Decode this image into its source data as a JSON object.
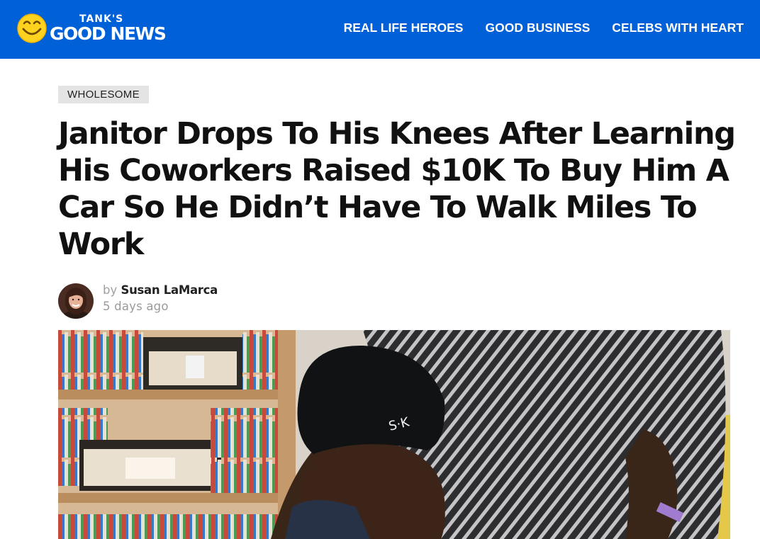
{
  "header": {
    "logo": {
      "top_text": "TANK'S",
      "main_text": "GOOD NEWS"
    },
    "nav": [
      {
        "label": "REAL LIFE HEROES"
      },
      {
        "label": "GOOD BUSINESS"
      },
      {
        "label": "CELEBS WITH HEART"
      }
    ],
    "colors": {
      "bar": "#0060d8",
      "logo_face": "#ffd21f"
    }
  },
  "article": {
    "category": "WHOLESOME",
    "title": "Janitor Drops To His Knees After Learning His Coworkers Raised $10K To Buy Him A Car So He Didn’t Have To Walk Miles To Work",
    "byline": {
      "by": "by",
      "author": "Susan LaMarca",
      "date": "5 days ago"
    },
    "hero_image": {
      "icon": "photo-hug-classroom"
    }
  }
}
